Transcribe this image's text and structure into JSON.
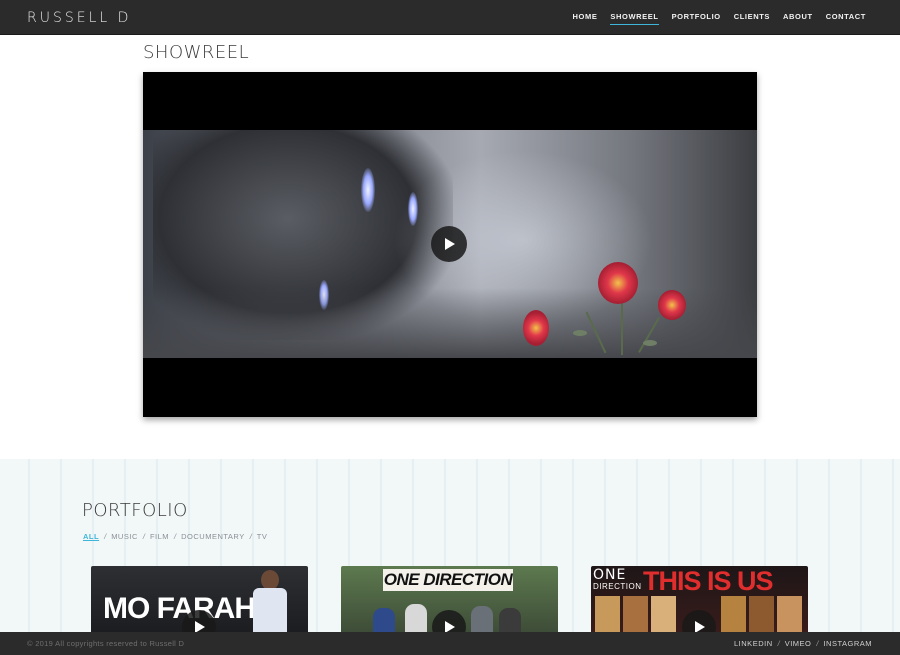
{
  "brand": "RUSSELL D",
  "nav": {
    "home": "HOME",
    "showreel": "SHOWREEL",
    "portfolio": "PORTFOLIO",
    "clients": "CLIENTS",
    "about": "ABOUT",
    "contact": "CONTACT",
    "active": "SHOWREEL"
  },
  "showreel": {
    "title": "SHOWREEL"
  },
  "portfolio": {
    "title": "PORTFOLIO",
    "filters": [
      "ALL",
      "MUSIC",
      "FILM",
      "DOCUMENTARY",
      "TV"
    ],
    "active_filter": "ALL",
    "filter_separator": "/",
    "items": [
      {
        "thumb_text": "MO FARAH"
      },
      {
        "thumb_text": "ONE DIRECTION"
      },
      {
        "thumb_text_1": "ONE",
        "thumb_text_2": "DIRECTION",
        "thumb_text_3": "THIS IS US"
      }
    ]
  },
  "footer": {
    "copyright": "© 2019 All copyrights reserved to Russell D",
    "social": [
      "LINKEDIN",
      "VIMEO",
      "INSTAGRAM"
    ],
    "separator": "/"
  },
  "colors": {
    "accent": "#3fb6d9",
    "header_bg": "#2b2b2b",
    "portfolio_bg": "#f2f7f8",
    "thumb_red": "#e02d2d"
  },
  "icons": {
    "play": "play-icon"
  }
}
